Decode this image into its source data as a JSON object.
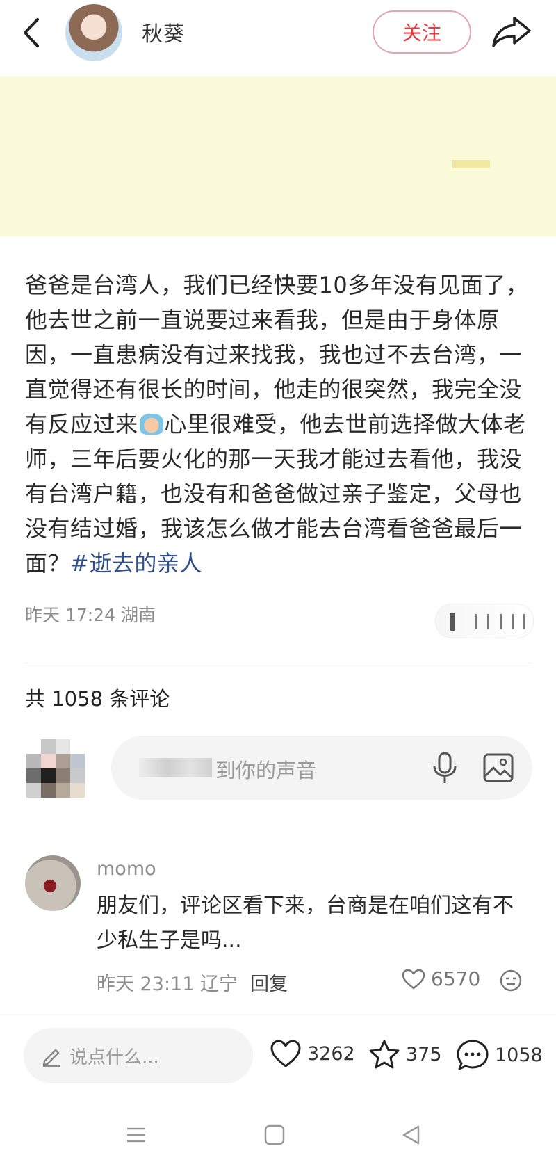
{
  "header": {
    "username": "秋葵",
    "follow_label": "关注"
  },
  "post": {
    "text": "爸爸是台湾人，我们已经快要10多年没有见面了，他去世之前一直说要过来看我，但是由于身体原因，一直患病没有过来找我，我也过不去台湾，一直觉得还有很长的时间，他走的很突然，我完全没有反应过来",
    "text_after_emoji": "心里很难受，他去世前选择做大体老师，三年后要火化的那一天我才能过去看他，我没有台湾户籍，也没有和爸爸做过亲子鉴定，父母也没有结过婚，我该怎么做才能去台湾看爸爸最后一面？",
    "hashtag": "#逝去的亲人",
    "meta": "昨天 17:24 湖南"
  },
  "comments": {
    "count_label": "共 1058 条评论",
    "input_placeholder": "到你的声音",
    "items": [
      {
        "name": "momo",
        "text": "朋友们，评论区看下来，台商是在咱们这有不少私生子是吗...",
        "meta": "昨天 23:11 辽宁",
        "reply_label": "回复",
        "likes": "6570"
      }
    ]
  },
  "bottom_bar": {
    "say_placeholder": "说点什么...",
    "likes": "3262",
    "stars": "375",
    "comments": "1058"
  },
  "colors": {
    "accent": "#e5393f",
    "hashtag": "#2f4f8a",
    "image_bg": "#fcfbd9"
  }
}
